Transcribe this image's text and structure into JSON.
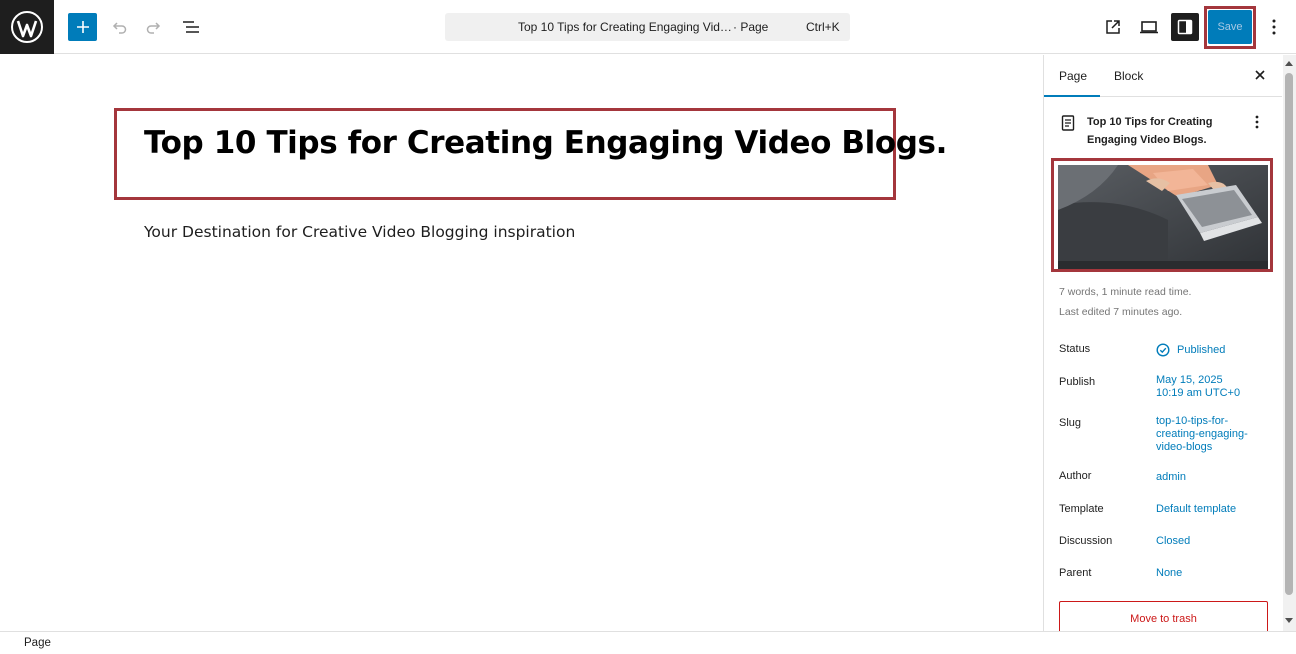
{
  "toolbar": {
    "logo_icon": "wordpress-icon",
    "add_block_icon": "plus-icon",
    "undo_icon": "undo-icon",
    "redo_icon": "redo-icon",
    "list_view_icon": "list-view-icon",
    "document_bar": {
      "title": "Top 10 Tips for Creating Engaging Vid…",
      "kind": "· Page",
      "shortcut": "Ctrl+K"
    },
    "view_page_icon": "external-link-icon",
    "preview_icon": "desktop-preview-icon",
    "settings_icon": "sidebar-settings-icon",
    "save_label": "Save",
    "options_icon": "more-vertical-icon",
    "accent_color": "#007cba",
    "highlight_color": "#a4363c"
  },
  "editor": {
    "title": "Top 10 Tips for Creating Engaging Video Blogs.",
    "paragraph": "Your Destination for Creative Video Blogging inspiration"
  },
  "footer": {
    "breadcrumb": "Page"
  },
  "sidebar": {
    "tabs": [
      {
        "label": "Page",
        "active": true
      },
      {
        "label": "Block",
        "active": false
      }
    ],
    "close_icon": "close-icon",
    "summary": {
      "icon": "page-document-icon",
      "title": "Top 10 Tips for Creating Engaging Video Blogs.",
      "menu_icon": "more-vertical-icon"
    },
    "featured_image": "laptop-typing-photo",
    "meta": {
      "words": "7 words, 1 minute read time.",
      "edited": "Last edited 7 minutes ago."
    },
    "rows": {
      "status": {
        "label": "Status",
        "value": "Published",
        "icon": "published-check-icon"
      },
      "publish": {
        "label": "Publish",
        "line1": "May 15, 2025",
        "line2": "10:19 am UTC+0"
      },
      "slug": {
        "label": "Slug",
        "line1": "top-10-tips-for-",
        "line2": "creating-engaging-",
        "line3": "video-blogs"
      },
      "author": {
        "label": "Author",
        "value": "admin"
      },
      "template": {
        "label": "Template",
        "value": "Default template"
      },
      "discussion": {
        "label": "Discussion",
        "value": "Closed"
      },
      "parent": {
        "label": "Parent",
        "value": "None"
      }
    },
    "trash_label": "Move to trash"
  }
}
